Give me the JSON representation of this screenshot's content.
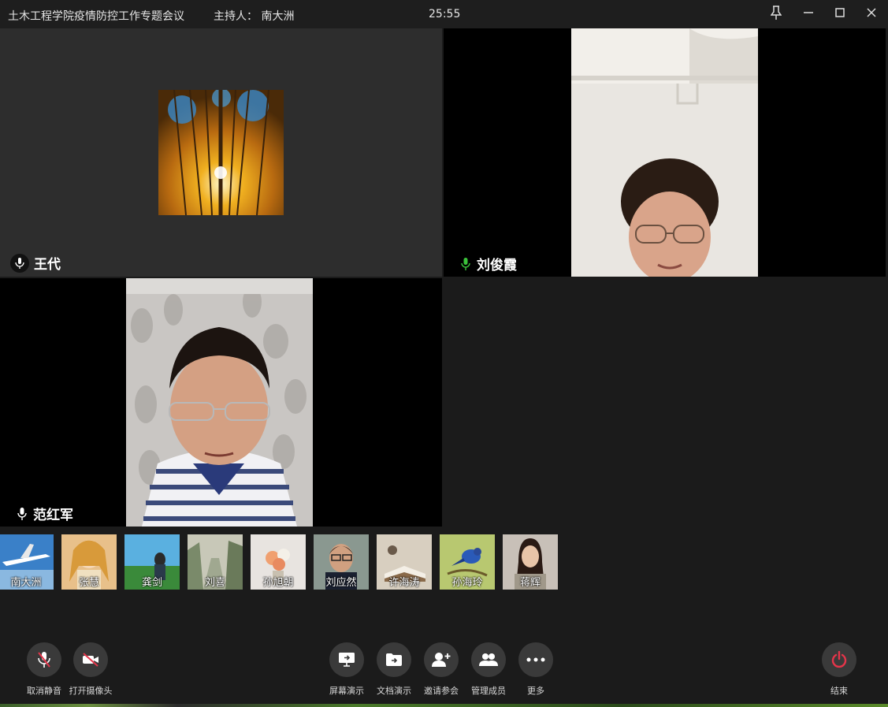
{
  "window": {
    "title": "土木工程学院疫情防控工作专题会议",
    "host_text": "主持人： 南大洲",
    "timer": "25:55"
  },
  "tiles": [
    {
      "name": "王代",
      "mic": "muted-dark"
    },
    {
      "name": "刘俊霞",
      "mic": "active-green"
    },
    {
      "name": "范红军",
      "mic": "muted-dark"
    }
  ],
  "participants": [
    {
      "name": "南大洲",
      "avatar": "airplane"
    },
    {
      "name": "张慧",
      "avatar": "anime-girl"
    },
    {
      "name": "龚剑",
      "avatar": "landscape-person"
    },
    {
      "name": "刘喜",
      "avatar": "canyon"
    },
    {
      "name": "孙旭朝",
      "avatar": "flowers"
    },
    {
      "name": "刘应然",
      "avatar": "man-portrait"
    },
    {
      "name": "许海涛",
      "avatar": "book"
    },
    {
      "name": "孙海玲",
      "avatar": "blue-bird"
    },
    {
      "name": "蒋辉",
      "avatar": "woman-portrait"
    }
  ],
  "toolbar": {
    "unmute": "取消静音",
    "open_camera": "打开摄像头",
    "screen_share": "屏幕演示",
    "doc_share": "文档演示",
    "invite": "邀请参会",
    "manage": "管理成员",
    "more": "更多",
    "end": "结束"
  },
  "colors": {
    "end_red": "#e5354a",
    "mic_green": "#3bc23b",
    "button_bg": "#3a3a3a"
  }
}
